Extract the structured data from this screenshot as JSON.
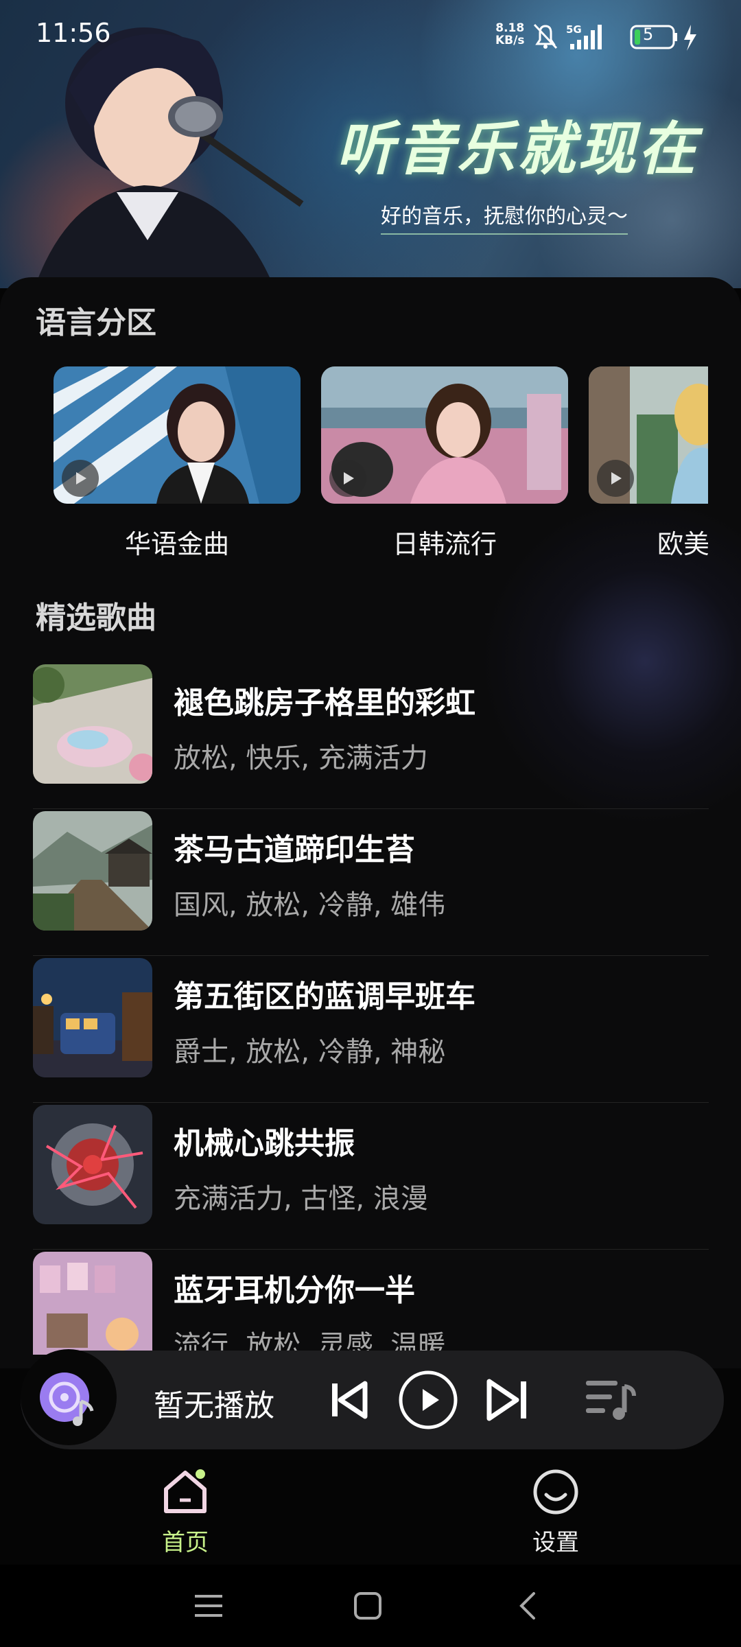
{
  "status_bar": {
    "time": "11:56",
    "net_speed_value": "8.18",
    "net_speed_unit": "KB/s",
    "network": "5G",
    "battery": "5"
  },
  "hero": {
    "title": "听音乐就现在",
    "subtitle": "好的音乐，抚慰你的心灵～"
  },
  "language_section": {
    "title": "语言分区",
    "items": [
      {
        "label": "华语金曲"
      },
      {
        "label": "日韩流行"
      },
      {
        "label": "欧美"
      }
    ]
  },
  "songs_section": {
    "title": "精选歌曲",
    "items": [
      {
        "title": "褪色跳房子格里的彩虹",
        "tags": "放松, 快乐, 充满活力"
      },
      {
        "title": "茶马古道蹄印生苔",
        "tags": "国风, 放松, 冷静, 雄伟"
      },
      {
        "title": "第五街区的蓝调早班车",
        "tags": "爵士, 放松, 冷静, 神秘"
      },
      {
        "title": "机械心跳共振",
        "tags": "充满活力, 古怪, 浪漫"
      },
      {
        "title": "蓝牙耳机分你一半",
        "tags": "流行, 放松, 灵感, 温暖"
      }
    ]
  },
  "player": {
    "now_playing": "暂无播放"
  },
  "nav": {
    "home": "首页",
    "settings": "设置"
  },
  "colors": {
    "accent": "#c8f28a",
    "background": "#0b0b0c",
    "player_bg": "#1e1e20"
  }
}
